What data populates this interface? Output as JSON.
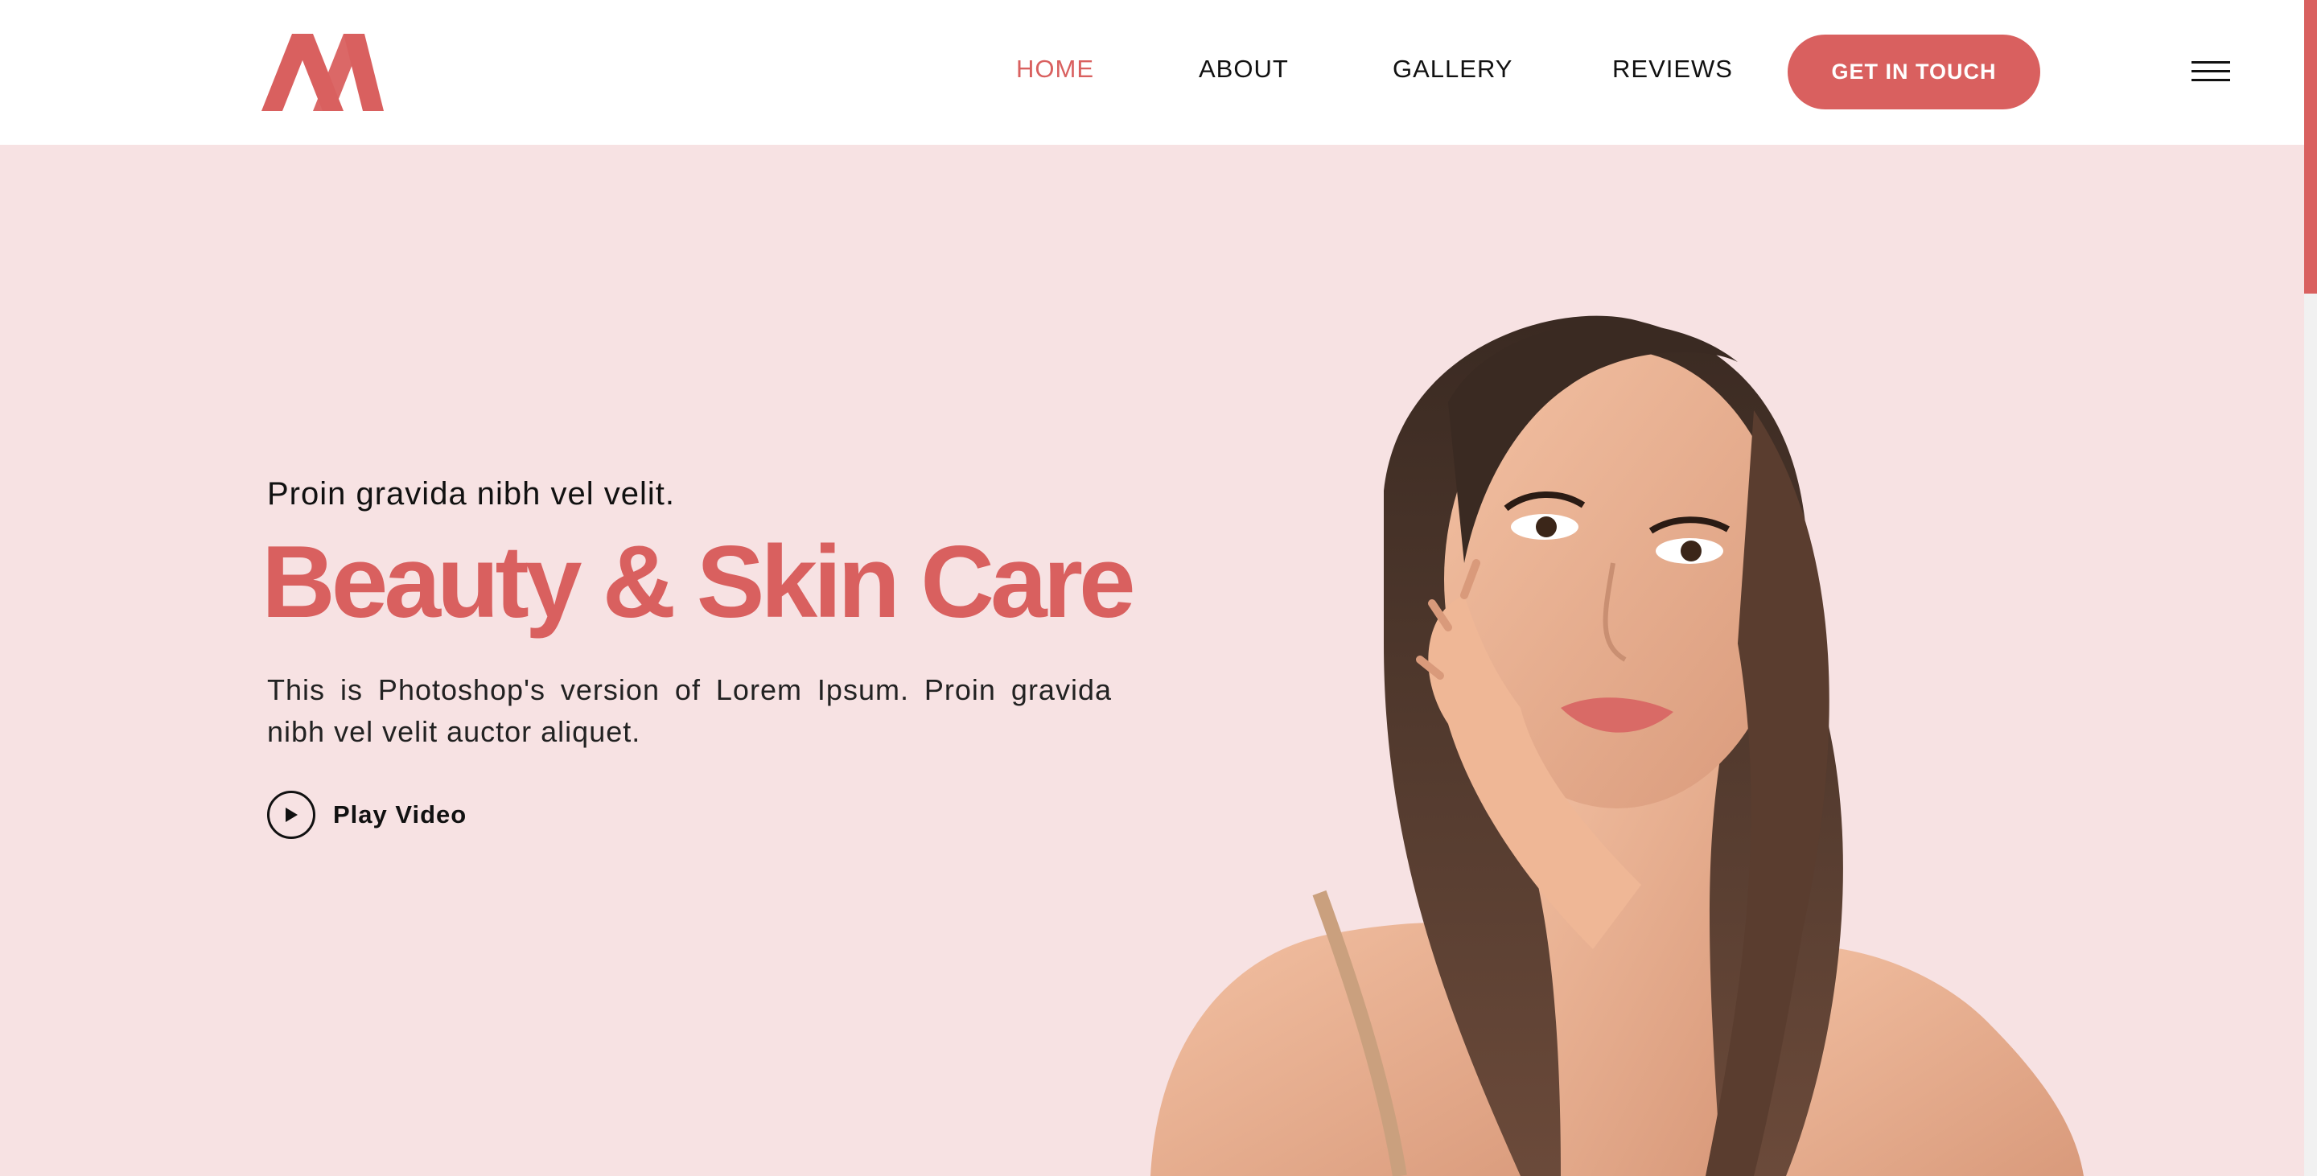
{
  "header": {
    "logo_alt": "M logo",
    "nav": [
      {
        "label": "HOME",
        "active": true
      },
      {
        "label": "ABOUT",
        "active": false
      },
      {
        "label": "GALLERY",
        "active": false
      },
      {
        "label": "REVIEWS",
        "active": false
      }
    ],
    "cta_label": "GET IN TOUCH",
    "menu_icon": "hamburger-icon"
  },
  "hero": {
    "kicker": "Proin gravida nibh vel velit.",
    "title": "Beauty & Skin Care",
    "description": "This is Photoshop's version of Lorem Ipsum. Proin gravida nibh vel velit auctor aliquet.",
    "play_label": "Play Video",
    "play_icon": "play-icon",
    "image_subject": "woman-portrait"
  },
  "colors": {
    "accent": "#d9605f",
    "hero_background": "#f7e2e3",
    "text_dark": "#111111"
  }
}
